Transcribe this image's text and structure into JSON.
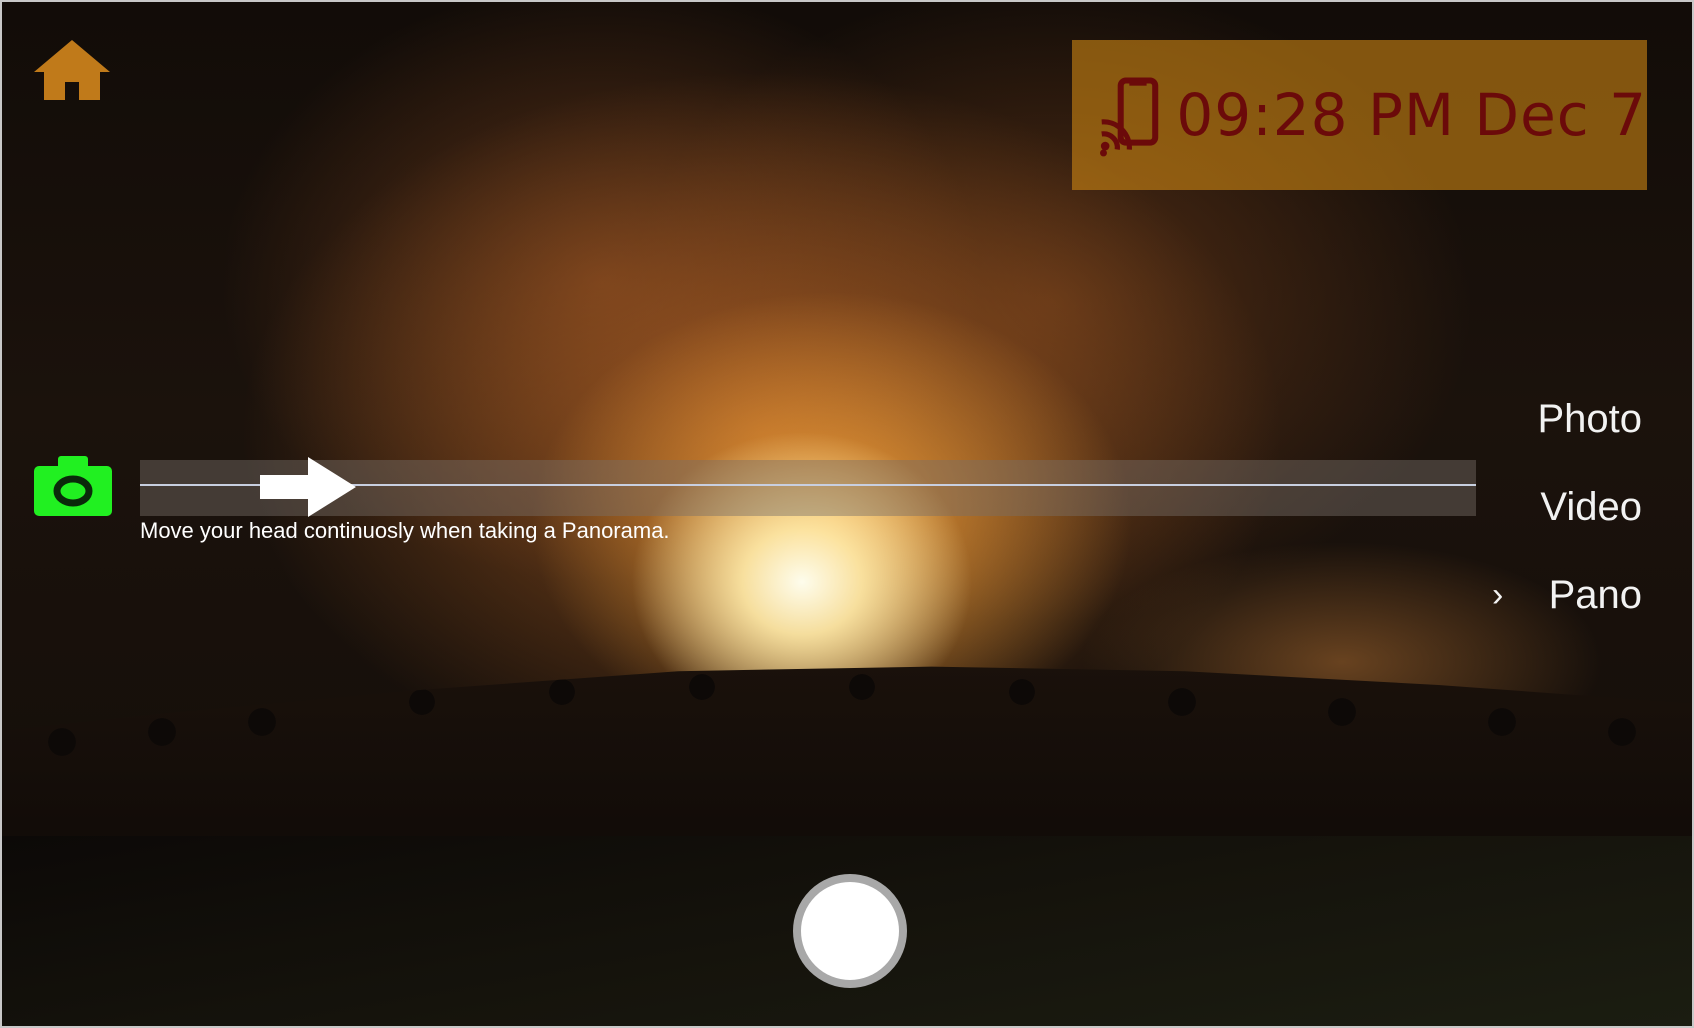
{
  "header": {
    "home_icon": "home-icon",
    "clock": "09:28 PM Dec 7",
    "cast_icon": "cast-to-device-icon"
  },
  "modes": {
    "items": [
      {
        "label": "Photo",
        "selected": false
      },
      {
        "label": "Video",
        "selected": false
      },
      {
        "label": "Pano",
        "selected": true
      }
    ],
    "chevron": "›"
  },
  "pano": {
    "camera_icon": "camera-icon",
    "hint": "Move your head continuosly when taking a Panorama.",
    "direction_icon": "right-arrow-icon"
  },
  "shutter": {
    "icon": "shutter-button"
  },
  "colors": {
    "home": "#c07a1a",
    "clock_bg": "#c8821a",
    "clock_text": "#6b0a0a",
    "camera_icon": "#21f021",
    "shutter_ring": "#a8a8a8"
  }
}
